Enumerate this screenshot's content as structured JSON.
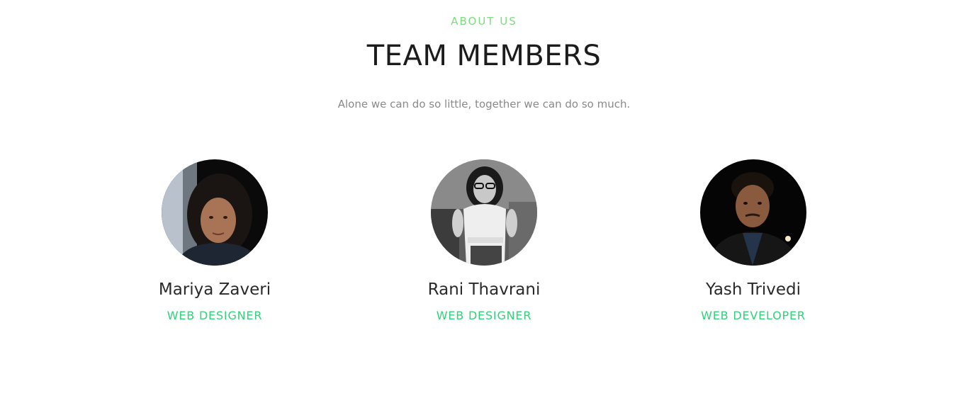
{
  "header": {
    "eyebrow": "ABOUT US",
    "title": "TEAM MEMBERS",
    "subtitle": "Alone we can do so little, together we can do so much."
  },
  "members": [
    {
      "name": "Mariya Zaveri",
      "role": "WEB DESIGNER",
      "photo_icon": "avatar-photo"
    },
    {
      "name": "Rani Thavrani",
      "role": "WEB DESIGNER",
      "photo_icon": "avatar-photo"
    },
    {
      "name": "Yash Trivedi",
      "role": "WEB DEVELOPER",
      "photo_icon": "avatar-photo"
    }
  ],
  "colors": {
    "accent": "#2fd278",
    "eyebrow": "#7ddc7f",
    "title": "#1c1c1c",
    "subtitle": "#8a8a8a"
  }
}
